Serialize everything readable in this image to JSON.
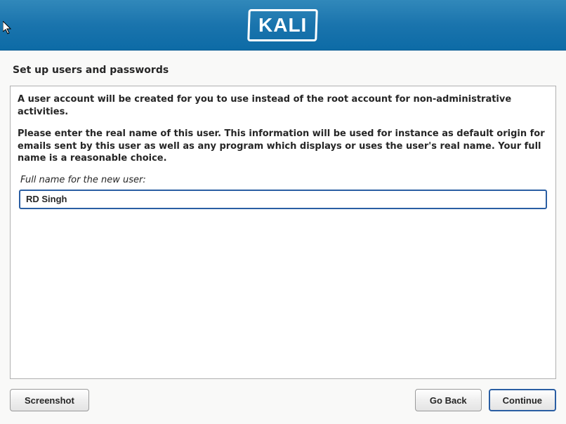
{
  "header": {
    "logo_text": "KALI"
  },
  "page": {
    "title": "Set up users and passwords"
  },
  "instructions": {
    "line1": "A user account will be created for you to use instead of the root account for non-administrative activities.",
    "line2": "Please enter the real name of this user. This information will be used for instance as default origin for emails sent by this user as well as any program which displays or uses the user's real name. Your full name is a reasonable choice."
  },
  "field": {
    "label": "Full name for the new user:",
    "value": "RD Singh"
  },
  "buttons": {
    "screenshot": "Screenshot",
    "go_back": "Go Back",
    "continue": "Continue"
  }
}
